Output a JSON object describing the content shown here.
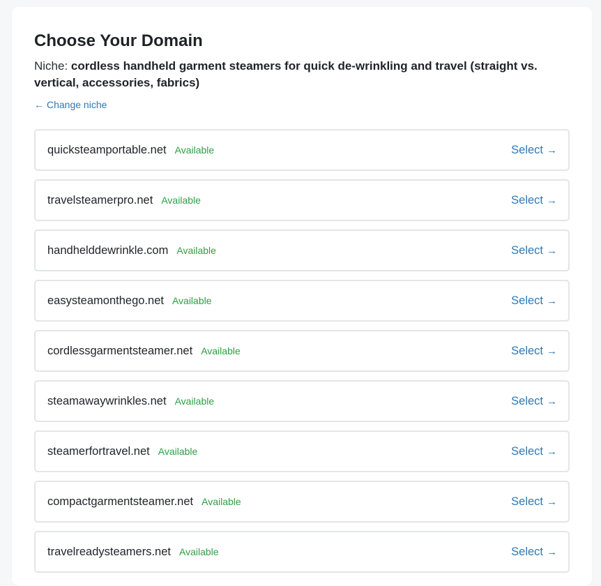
{
  "page": {
    "title": "Choose Your Domain",
    "niche_label": "Niche:",
    "niche_value": "cordless handheld garment steamers for quick de-wrinkling and travel (straight vs. vertical, accessories, fabrics)",
    "change_niche_label": "Change niche",
    "back_arrow": "←"
  },
  "domains": [
    {
      "name": "quicksteamportable.net",
      "status": "Available",
      "action": "Select",
      "arrow": "→"
    },
    {
      "name": "travelsteamerpro.net",
      "status": "Available",
      "action": "Select",
      "arrow": "→"
    },
    {
      "name": "handhelddewrinkle.com",
      "status": "Available",
      "action": "Select",
      "arrow": "→"
    },
    {
      "name": "easysteamonthego.net",
      "status": "Available",
      "action": "Select",
      "arrow": "→"
    },
    {
      "name": "cordlessgarmentsteamer.net",
      "status": "Available",
      "action": "Select",
      "arrow": "→"
    },
    {
      "name": "steamawaywrinkles.net",
      "status": "Available",
      "action": "Select",
      "arrow": "→"
    },
    {
      "name": "steamerfortravel.net",
      "status": "Available",
      "action": "Select",
      "arrow": "→"
    },
    {
      "name": "compactgarmentsteamer.net",
      "status": "Available",
      "action": "Select",
      "arrow": "→"
    },
    {
      "name": "travelreadysteamers.net",
      "status": "Available",
      "action": "Select",
      "arrow": "→"
    }
  ],
  "colors": {
    "accent": "#2f78b4",
    "available": "#2f9e44",
    "border": "#e3e5e8"
  }
}
